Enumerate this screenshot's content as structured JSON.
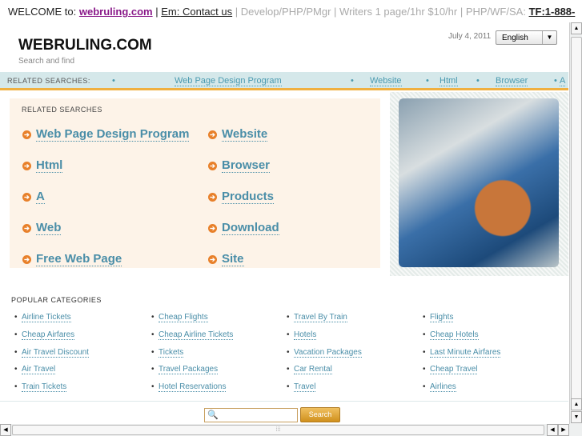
{
  "topbar": {
    "welcome": "WELCOME to:",
    "site": "webruling.com",
    "sep1": "|",
    "contact": "Em: Contact us",
    "rest": "| Develop/PHP/PMgr | Writers 1 page/1hr $10/hr | PHP/WF/SA:",
    "tf": "TF:1-888-"
  },
  "header": {
    "logo": "WEBRULING.COM",
    "tagline": "Search and find",
    "date": "July 4, 2011",
    "language": "English"
  },
  "related_bar": {
    "label": "RELATED SEARCHES:",
    "items": [
      "Web Page Design Program",
      "Website",
      "Html",
      "Browser",
      "A"
    ]
  },
  "related_panel": {
    "title": "RELATED SEARCHES",
    "items": [
      "Web Page Design Program",
      "Website",
      "Html",
      "Browser",
      "A",
      "Products",
      "Web",
      "Download",
      "Free Web Page",
      "Site"
    ]
  },
  "popular": {
    "title": "POPULAR CATEGORIES",
    "items": [
      "Airline Tickets",
      "Cheap Flights",
      "Travel By Train",
      "Flights",
      "Cheap Airfares",
      "Cheap Airline Tickets",
      "Hotels",
      "Cheap Hotels",
      "Air Travel Discount",
      "Tickets",
      "Vacation Packages",
      "Last Minute Airfares",
      "Air Travel",
      "Travel Packages",
      "Car Rental",
      "Cheap Travel",
      "Train Tickets",
      "Hotel Reservations",
      "Travel",
      "Airlines"
    ]
  },
  "search": {
    "value": "",
    "button": "Search"
  }
}
